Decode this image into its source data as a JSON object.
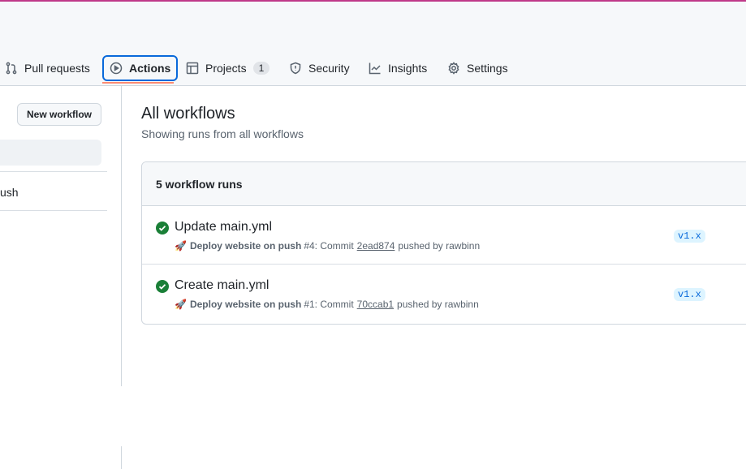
{
  "nav": {
    "tabs": [
      {
        "label": "Pull requests",
        "icon": "git-pull-request-icon"
      },
      {
        "label": "Actions",
        "icon": "play-icon",
        "active": true
      },
      {
        "label": "Projects",
        "icon": "table-icon",
        "count": "1"
      },
      {
        "label": "Security",
        "icon": "shield-icon"
      },
      {
        "label": "Insights",
        "icon": "graph-icon"
      },
      {
        "label": "Settings",
        "icon": "gear-icon"
      }
    ]
  },
  "sidebar": {
    "new_workflow": "New workflow",
    "item": "ush"
  },
  "main": {
    "title": "All workflows",
    "subtitle": "Showing runs from all workflows",
    "runs_count": "5 workflow runs",
    "runs": [
      {
        "title": "Update main.yml",
        "workflow": "Deploy website on push",
        "number": "#4",
        "pre": ": Commit",
        "commit": "2ead874",
        "post": "pushed by rawbinn",
        "branch": "v1.x",
        "status": "success"
      },
      {
        "title": "Create main.yml",
        "workflow": "Deploy website on push",
        "number": "#1",
        "pre": ": Commit",
        "commit": "70ccab1",
        "post": "pushed by rawbinn",
        "branch": "v1.x",
        "status": "success"
      }
    ]
  },
  "colors": {
    "accent": "#0969da",
    "success": "#1a7f37",
    "tab_underline": "#fd8c73"
  }
}
